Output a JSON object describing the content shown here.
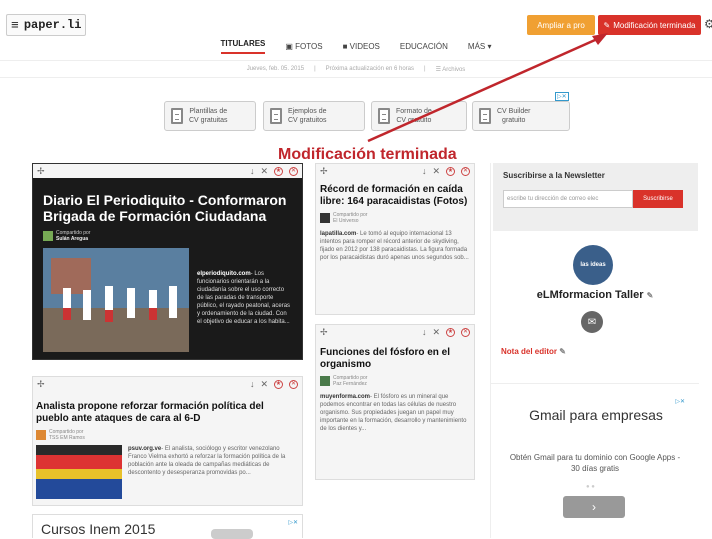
{
  "header": {
    "logo": "paper.li",
    "btn_enlarge": "Ampliar a pro",
    "btn_done": "Modificación terminada"
  },
  "nav": {
    "tabs": [
      "TITULARES",
      "FOTOS",
      "VIDEOS",
      "EDUCACIÓN",
      "MÁS ▾"
    ]
  },
  "subline": {
    "date": "Jueves, feb. 05. 2015",
    "next": "Próxima actualización en 6 horas",
    "archive": "Archivos"
  },
  "ads": {
    "tag": "▷✕",
    "items": [
      {
        "label": "Plantillas de\nCV gratuitas"
      },
      {
        "label": "Ejemplos de\nCV gratuitos"
      },
      {
        "label": "Formato de\nCV gratuito"
      },
      {
        "label": "CV Builder\ngratuito"
      }
    ]
  },
  "annotation": "Modificación terminada",
  "card1": {
    "title": "Diario El Periodiquito - Conformaron Brigada de Formación Ciudadana",
    "shared_by": "Compartido por",
    "author": "Sulán Aregua",
    "source": "elperiodiquito.com",
    "text": "- Los funcionarios orientarán a la ciudadanía sobre el uso correcto de las paradas de transporte público, el rayado peatonal, aceras y ordenamiento de la ciudad. Con el objetivo de educar a los habita..."
  },
  "card2": {
    "title": "Analista propone reforzar formación política del pueblo ante ataques de cara al 6-D",
    "shared_by": "Compartido por",
    "author": "TSS EM Ramos",
    "source": "psuv.org.ve",
    "text": "- El analista, sociólogo y escritor venezolano Franco Vielma exhortó a reforzar la formación política de la población ante la oleada de campañas mediáticas de descontento y desesperanza promovidas po..."
  },
  "card3": {
    "title": "Récord de formación en caída libre: 164 paracaidistas (Fotos)",
    "shared_by": "Compartido por",
    "author": "El Universo",
    "source": "lapatilla.com",
    "text": "- Le tomó al equipo internacional 13 intentos para romper el récord anterior de skydiving, fijado en 2012 por 138 paracaidistas. La figura formada por los paracaidistas duró apenas unos segundos sob..."
  },
  "card4": {
    "title": "Funciones del fósforo en el organismo",
    "shared_by": "Compartido por",
    "author": "Paz Fernández",
    "source": "muyenforma.com",
    "text": "- El fósforo es un mineral que podemos encontrar en todas las células de nuestro organismo. Sus propiedades juegan un papel muy importante en la formación, desarrollo y mantenimiento de los dientes y..."
  },
  "bottom_ad": {
    "title": "Cursos Inem 2015",
    "tag": "▷✕"
  },
  "sidebar": {
    "newsletter_title": "Suscribirse a la Newsletter",
    "email_placeholder": "escribe tu dirección de correo elec",
    "subscribe": "Suscribirse",
    "avatar_text": "las ideas",
    "profile_name": "eLMformacion Taller",
    "editor_note": "Nota del editor",
    "ad_tag": "▷✕",
    "ad_title": "Gmail para empresas",
    "ad_body": "Obtén Gmail para tu dominio con Google Apps - 30 días gratis",
    "ad_btn": "›"
  }
}
